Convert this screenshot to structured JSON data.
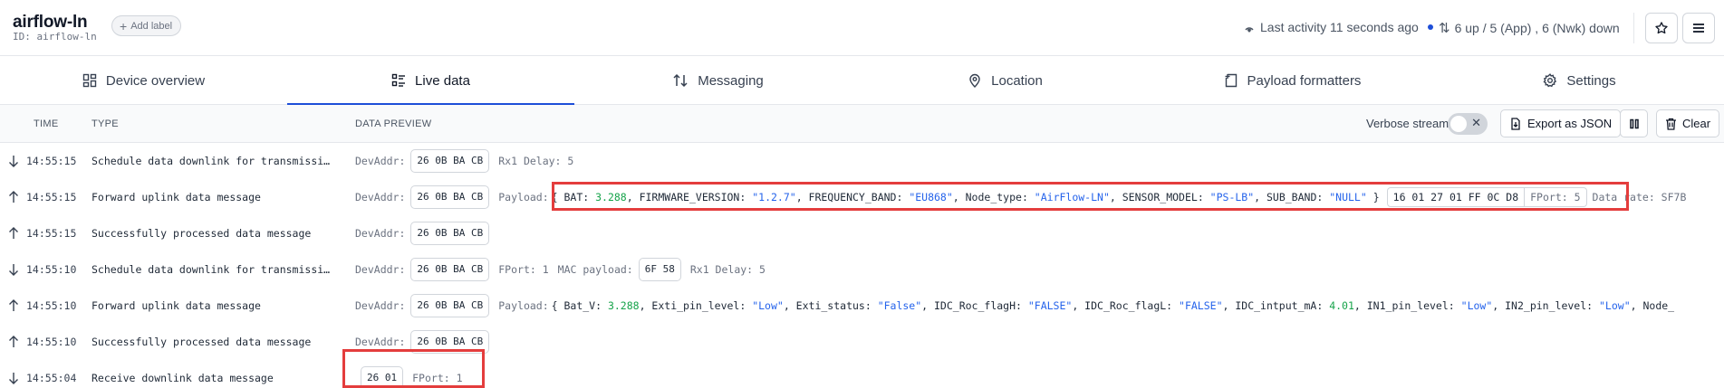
{
  "device": {
    "name": "airflow-ln",
    "id_label": "ID: airflow-ln",
    "add_label": "Add label"
  },
  "status": {
    "last_activity": "Last activity 11 seconds ago",
    "traffic": "6 up / 5 (App) , 6 (Nwk) down"
  },
  "tabs": [
    {
      "label": "Device overview",
      "icon": "overview-icon"
    },
    {
      "label": "Live data",
      "icon": "live-data-icon",
      "active": true
    },
    {
      "label": "Messaging",
      "icon": "messaging-icon"
    },
    {
      "label": "Location",
      "icon": "location-icon"
    },
    {
      "label": "Payload formatters",
      "icon": "payload-formatters-icon"
    },
    {
      "label": "Settings",
      "icon": "settings-icon"
    }
  ],
  "table": {
    "columns": {
      "time": "TIME",
      "type": "TYPE",
      "preview": "DATA PREVIEW"
    },
    "verbose_label": "Verbose stream",
    "export_label": "Export as JSON",
    "clear_label": "Clear"
  },
  "rows": [
    {
      "direction": "down",
      "time": "14:55:15",
      "type": "Schedule data downlink for transmissi…",
      "devaddr_label": "DevAddr:",
      "devaddr": "26 0B BA CB",
      "extra": "Rx1 Delay: 5"
    },
    {
      "direction": "up",
      "time": "14:55:15",
      "type": "Forward uplink data message",
      "devaddr_label": "DevAddr:",
      "devaddr": "26 0B BA CB",
      "payload_label": "Payload:",
      "payload_text": "{ BAT: 3.288, FIRMWARE_VERSION: \"1.2.7\", FREQUENCY_BAND: \"EU868\", Node_type: \"AirFlow-LN\", SENSOR_MODEL: \"PS-LB\", SUB_BAND: \"NULL\" }",
      "raw_bytes": "16 01 27 01 FF 0C D8",
      "fport": "FPort: 5",
      "data_rate": "Data rate: SF7B"
    },
    {
      "direction": "up",
      "time": "14:55:15",
      "type": "Successfully processed data message",
      "devaddr_label": "DevAddr:",
      "devaddr": "26 0B BA CB"
    },
    {
      "direction": "down",
      "time": "14:55:10",
      "type": "Schedule data downlink for transmissi…",
      "devaddr_label": "DevAddr:",
      "devaddr": "26 0B BA CB",
      "fport": "FPort: 1",
      "mac_label": "MAC payload:",
      "mac": "6F 58",
      "extra": "Rx1 Delay: 5"
    },
    {
      "direction": "up",
      "time": "14:55:10",
      "type": "Forward uplink data message",
      "devaddr_label": "DevAddr:",
      "devaddr": "26 0B BA CB",
      "payload_label": "Payload:",
      "payload_text": "{ Bat_V: 3.288, Exti_pin_level: \"Low\", Exti_status: \"False\", IDC_Roc_flagH: \"FALSE\", IDC_Roc_flagL: \"FALSE\", IDC_intput_mA: 4.01, IN1_pin_level: \"Low\", IN2_pin_level: \"Low\", Node_"
    },
    {
      "direction": "up",
      "time": "14:55:10",
      "type": "Successfully processed data message",
      "devaddr_label": "DevAddr:",
      "devaddr": "26 0B BA CB"
    },
    {
      "direction": "down",
      "time": "14:55:04",
      "type": "Receive downlink data message",
      "raw": "26 01",
      "fport": "FPort: 1"
    }
  ],
  "colors": {
    "accent": "#1d4ed8",
    "string_value": "#2563eb",
    "number_value": "#16a34a",
    "highlight": "#e43d3d"
  }
}
